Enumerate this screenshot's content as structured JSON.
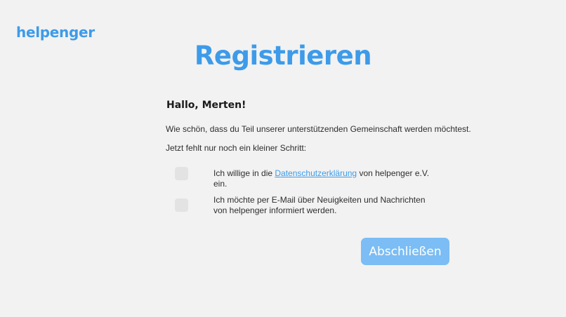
{
  "brand": {
    "logo_text": "helpenger",
    "accent_color": "#3d9be9"
  },
  "page": {
    "title": "Registrieren",
    "greeting": "Hallo, Merten!",
    "intro": "Wie schön, dass du Teil unserer unterstützenden Gemeinschaft werden möchtest.",
    "step_hint": "Jetzt fehlt nur noch ein kleiner Schritt:"
  },
  "consents": {
    "privacy": {
      "text_before": "Ich willige in die ",
      "link_text": "Datenschutzerklärung",
      "text_after": " von helpenger e.V. ein.",
      "checked": false
    },
    "newsletter": {
      "text": "Ich möchte per E-Mail über Neuigkeiten und Nachrichten von helpenger informiert werden.",
      "checked": false
    }
  },
  "actions": {
    "submit_label": "Abschließen",
    "submit_color": "#7bbdf4"
  }
}
